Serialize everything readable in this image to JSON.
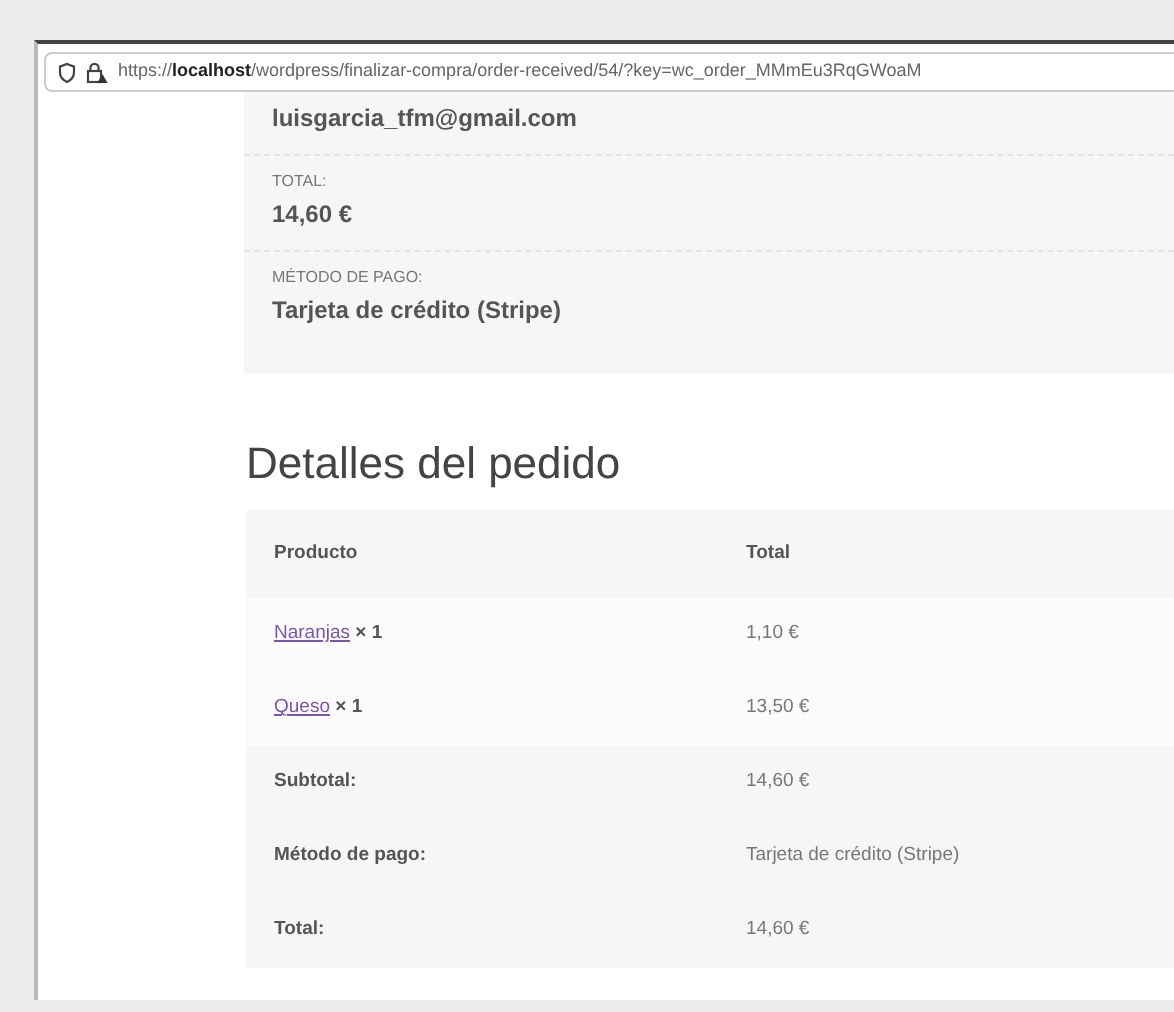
{
  "address_bar": {
    "url": "https://**localhost**/wordpress/finalizar-compra/order-received/54/?key=wc_order_MMmEu3RqGWoaM"
  },
  "order_overview": [
    {
      "value": "luisgarcia_tfm@gmail.com"
    },
    {
      "label": "TOTAL:",
      "value": "14,60 €"
    },
    {
      "label": "MÉTODO DE PAGO:",
      "value": "Tarjeta de crédito (Stripe)"
    }
  ],
  "order_details": {
    "title": "Detalles del pedido",
    "columns": [
      "Producto",
      "Total"
    ],
    "items": [
      {
        "product": "Naranjas",
        "quantity": "× 1",
        "total": "1,10 €"
      },
      {
        "product": "Queso",
        "quantity": "× 1",
        "total": "13,50 €"
      }
    ],
    "totals": [
      {
        "label": "Subtotal:",
        "value": "14,60 €"
      },
      {
        "label": "Método de pago:",
        "value": "Tarjeta de crédito (Stripe)"
      },
      {
        "label": "Total:",
        "value": "14,60 €"
      }
    ]
  }
}
